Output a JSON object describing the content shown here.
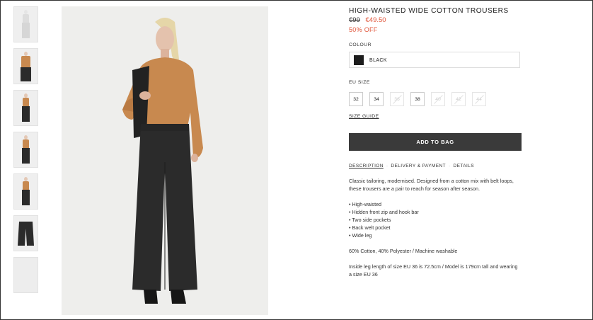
{
  "product": {
    "title": "HIGH-WAISTED WIDE COTTON TROUSERS",
    "old_price": "€99",
    "new_price": "€49.50",
    "discount": "50% OFF"
  },
  "colour": {
    "label": "COLOUR",
    "selected": "BLACK",
    "swatch_color": "#1d1d1d"
  },
  "sizes": {
    "label": "EU SIZE",
    "options": [
      {
        "size": "32",
        "available": true
      },
      {
        "size": "34",
        "available": true
      },
      {
        "size": "36",
        "available": false
      },
      {
        "size": "38",
        "available": true
      },
      {
        "size": "40",
        "available": false
      },
      {
        "size": "42",
        "available": false
      },
      {
        "size": "44",
        "available": false
      }
    ],
    "guide_label": "SIZE GUIDE"
  },
  "add_to_bag_label": "ADD TO BAG",
  "tabs": [
    {
      "label": "DESCRIPTION",
      "active": true
    },
    {
      "label": "DELIVERY & PAYMENT",
      "active": false
    },
    {
      "label": "DETAILS",
      "active": false
    }
  ],
  "tab_separator": "·",
  "description": {
    "intro": "Classic tailoring, modernised. Designed from a cotton mix with belt loops, these trousers are a pair to reach for season after season.",
    "bullets": [
      "• High-waisted",
      "• Hidden front zip and hook bar",
      "• Two side pockets",
      "• Back welt pocket",
      "• Wide leg"
    ],
    "composition": "60% Cotton, 40% Polyester / Machine washable",
    "fit": "Inside leg length of size EU 36 is 72.5cm / Model is 179cm tall and wearing a size EU 36"
  },
  "colors": {
    "sale": "#e0553a",
    "button": "#3a3a3a",
    "top": "#c8894f",
    "trousers": "#2b2b2b"
  }
}
